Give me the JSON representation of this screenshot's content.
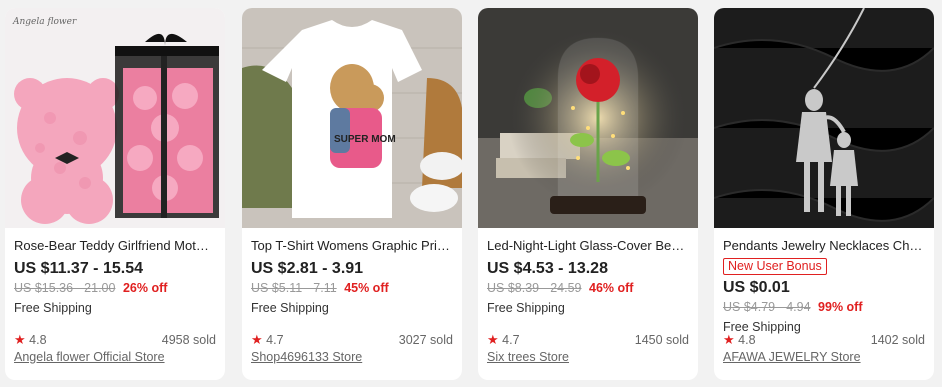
{
  "products": [
    {
      "watermark": "Angela flower",
      "title": "Rose-Bear Teddy Girlfriend Mothe...",
      "price": "US $11.37 - 15.54",
      "original_price": "US $15.36 - 21.00",
      "discount": "26% off",
      "shipping": "Free Shipping",
      "rating": "4.8",
      "sold": "4958 sold",
      "store": "Angela flower Official Store"
    },
    {
      "title": "Top T-Shirt Womens Graphic Print ...",
      "price": "US $2.81 - 3.91",
      "original_price": "US $5.11 - 7.11",
      "discount": "45% off",
      "shipping": "Free Shipping",
      "rating": "4.7",
      "sold": "3027 sold",
      "store": "Shop4696133 Store"
    },
    {
      "title": "Led-Night-Light Glass-Cover Beast ...",
      "price": "US $4.53 - 13.28",
      "original_price": "US $8.39 - 24.59",
      "discount": "46% off",
      "shipping": "Free Shipping",
      "rating": "4.7",
      "sold": "1450 sold",
      "store": "Six trees Store"
    },
    {
      "title": "Pendants Jewelry Necklaces Christ...",
      "badge": "New User Bonus",
      "price": "US $0.01",
      "original_price": "US $4.79 - 4.94",
      "discount": "99% off",
      "shipping": "Free Shipping",
      "rating": "4.8",
      "sold": "1402 sold",
      "store": "AFAWA JEWELRY Store"
    }
  ],
  "tshirt_print": "SUPER MOM",
  "colors": {
    "accent": "#e02020",
    "muted": "#999999",
    "card": "#ffffff",
    "page": "#f2f2f2"
  },
  "icons": {
    "rating": "star-icon"
  }
}
